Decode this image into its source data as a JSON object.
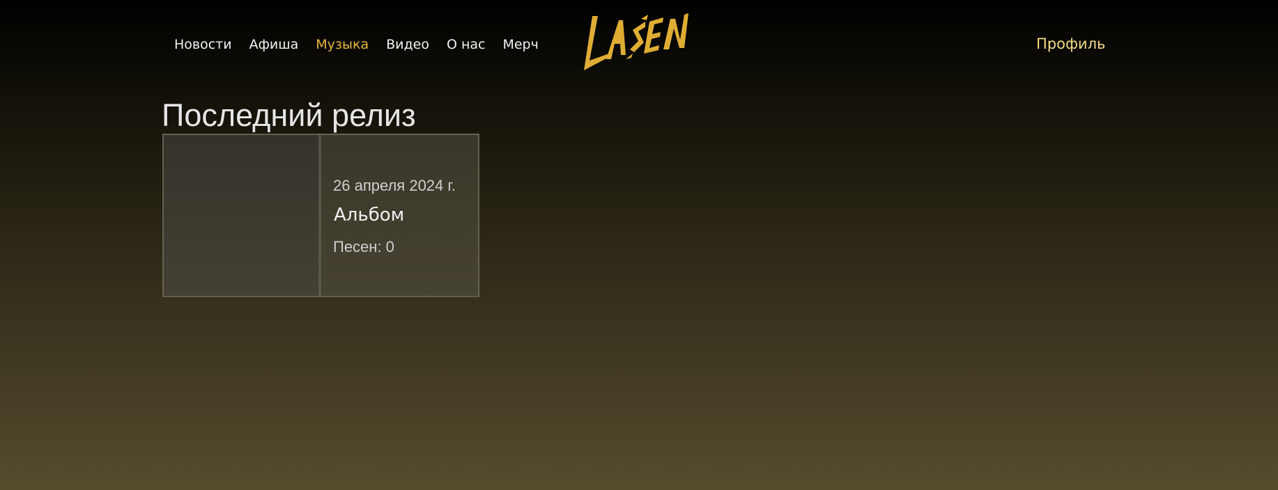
{
  "nav": {
    "items": [
      {
        "label": "Новости",
        "active": false
      },
      {
        "label": "Афиша",
        "active": false
      },
      {
        "label": "Музыка",
        "active": true
      },
      {
        "label": "Видео",
        "active": false
      },
      {
        "label": "О нас",
        "active": false
      },
      {
        "label": "Мерч",
        "active": false
      }
    ]
  },
  "logo": {
    "text": "LASEN",
    "color": "#e0ad34"
  },
  "profile": {
    "label": "Профиль"
  },
  "main": {
    "section_title": "Последний релиз",
    "release": {
      "date": "26 апреля 2024 г.",
      "type": "Альбом",
      "songs": "Песен: 0"
    }
  },
  "colors": {
    "accent": "#e8b53c",
    "profile": "#f1db84",
    "background_top": "#000000",
    "background_bottom": "#554c2d"
  }
}
